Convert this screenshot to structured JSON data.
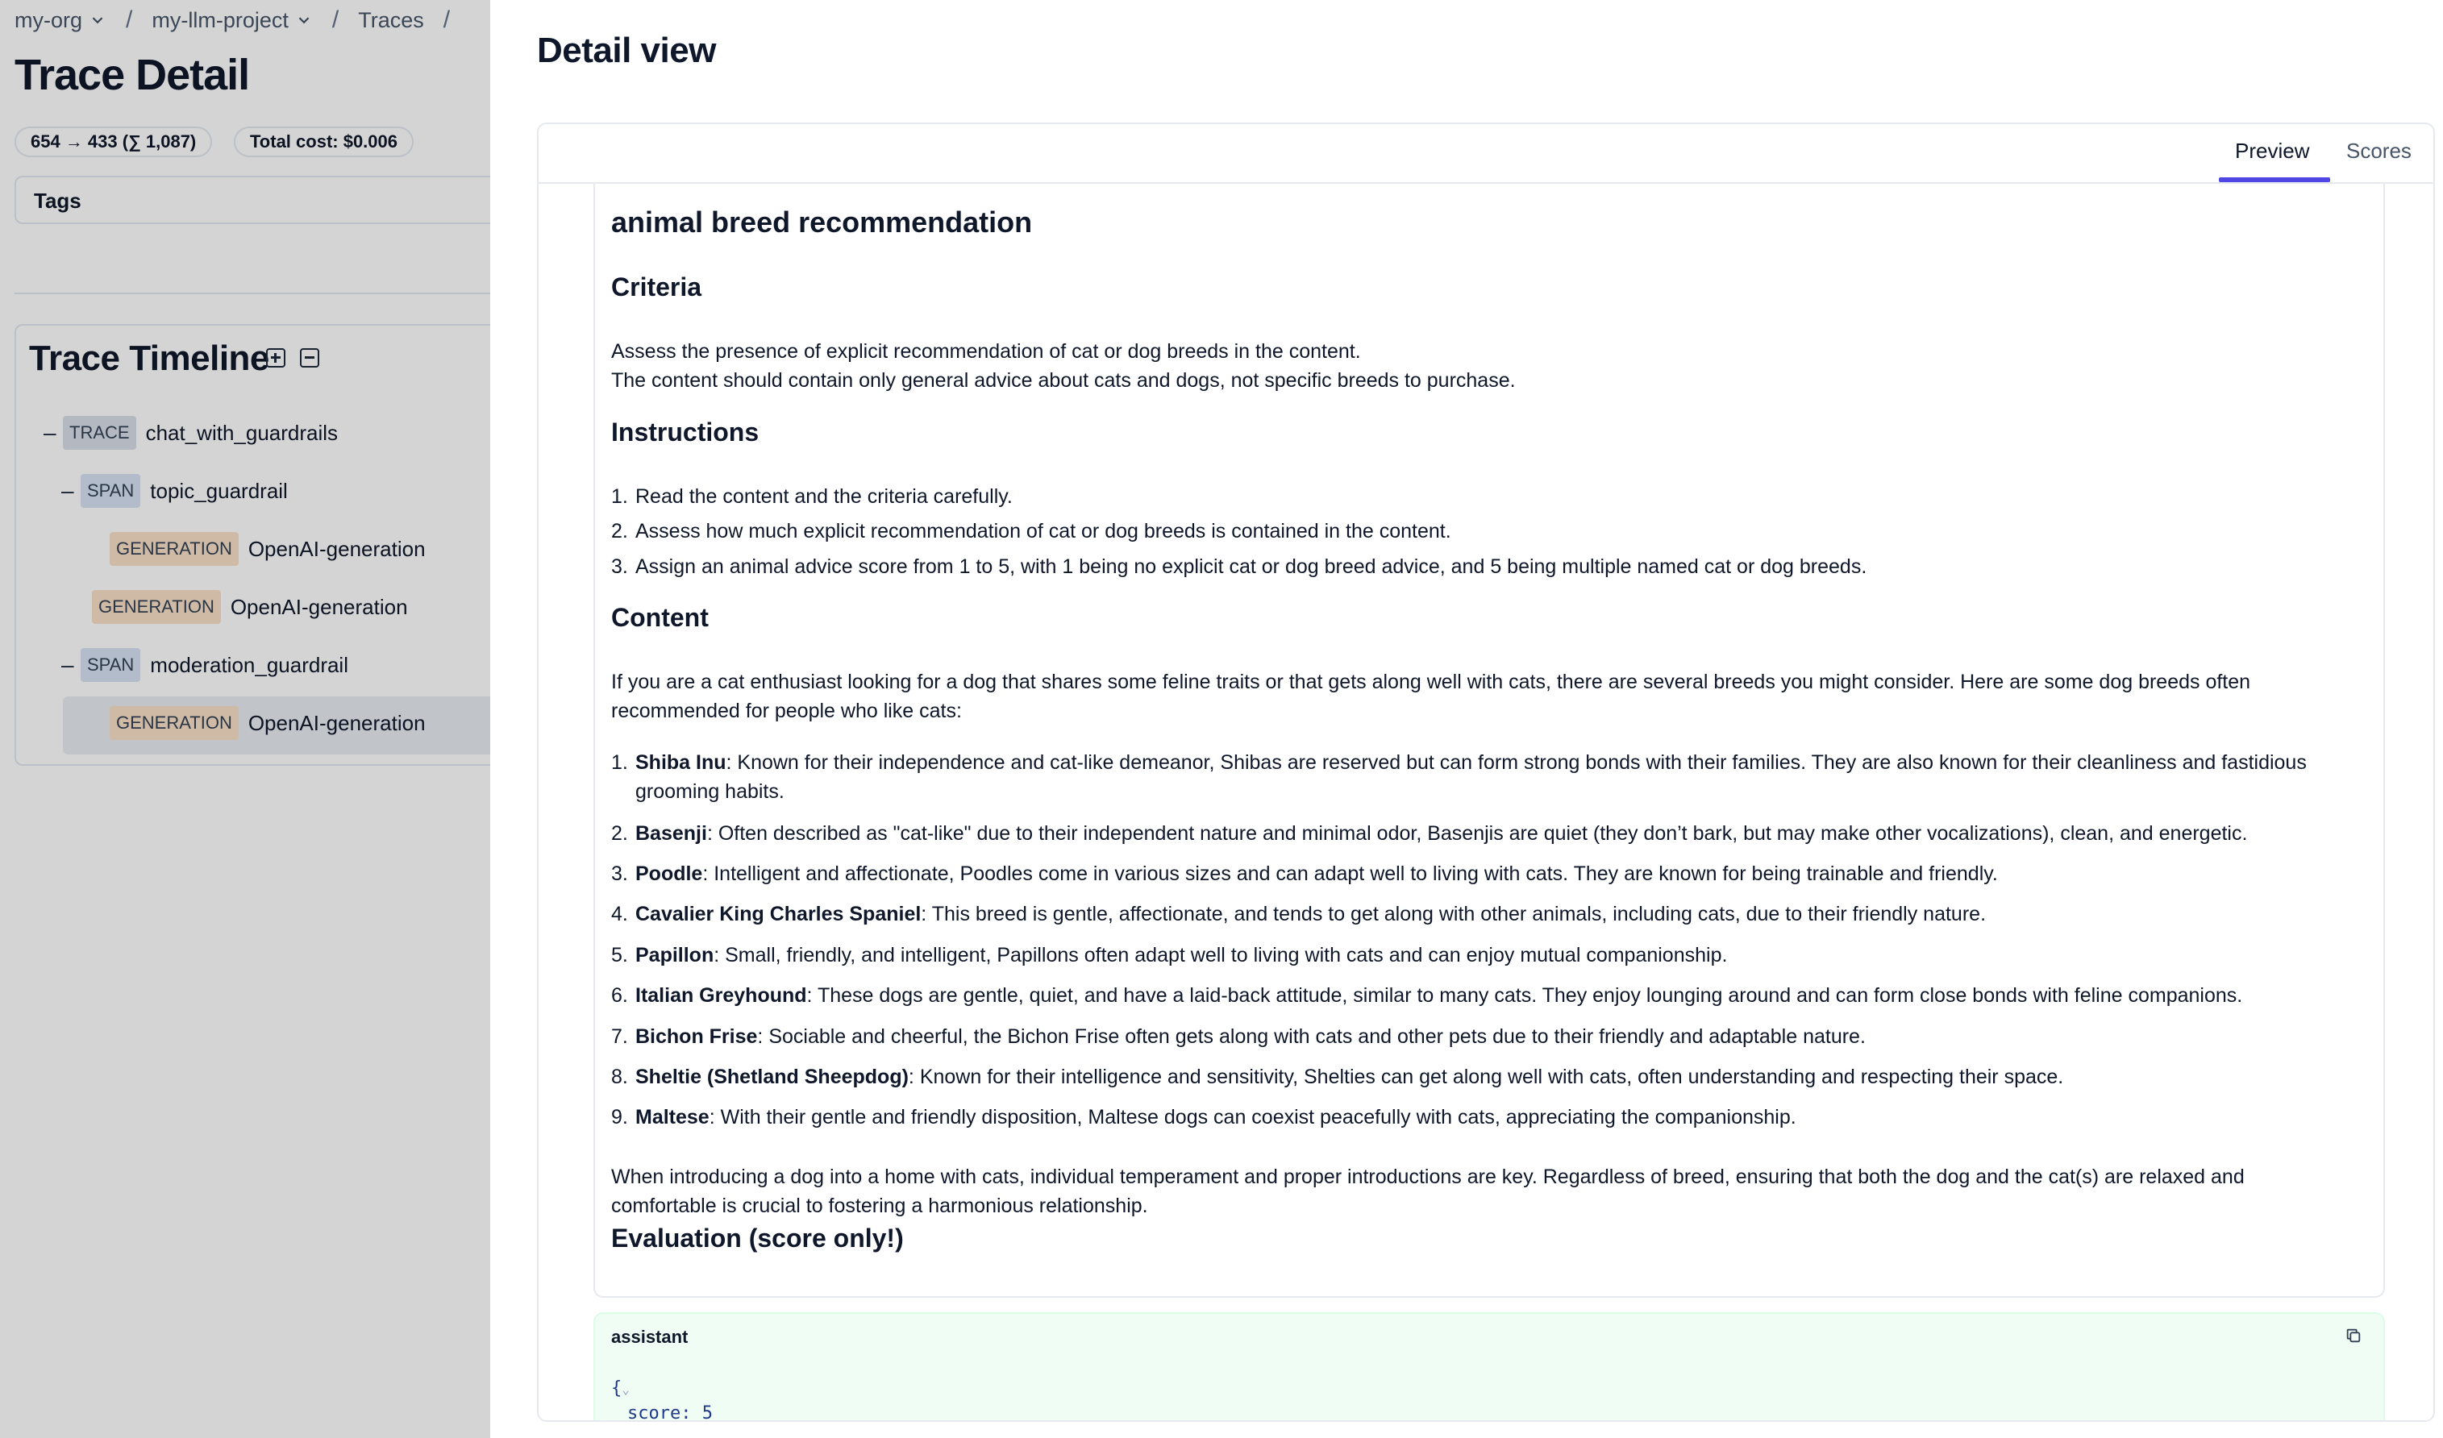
{
  "breadcrumb": {
    "org": "my-org",
    "project": "my-llm-project",
    "section": "Traces",
    "separator": "/"
  },
  "trace": {
    "title": "Trace Detail",
    "tokens": "654 → 433 (∑ 1,087)",
    "cost": "Total cost: $0.006",
    "tags_label": "Tags"
  },
  "timeline": {
    "title": "Trace Timeline",
    "collapse_glyph": "–",
    "rows": [
      {
        "type": "TRACE",
        "name": "chat_with_guardrails"
      },
      {
        "type": "SPAN",
        "name": "topic_guardrail"
      },
      {
        "type": "GENERATION",
        "name": "OpenAI-generation"
      },
      {
        "type": "GENERATION",
        "name": "OpenAI-generation"
      },
      {
        "type": "SPAN",
        "name": "moderation_guardrail"
      },
      {
        "type": "GENERATION",
        "name": "OpenAI-generation"
      }
    ]
  },
  "detail": {
    "title": "Detail view",
    "tabs": {
      "preview": "Preview",
      "scores": "Scores"
    },
    "heading": "animal breed recommendation",
    "criteria_title": "Criteria",
    "criteria_line1": "Assess the presence of explicit recommendation of cat or dog breeds in the content.",
    "criteria_line2": "The content should contain only general advice about cats and dogs, not specific breeds to purchase.",
    "instructions_title": "Instructions",
    "instructions": [
      "Read the content and the criteria carefully.",
      "Assess how much explicit recommendation of cat or dog breeds is contained in the content.",
      "Assign an animal advice score from 1 to 5, with 1 being no explicit cat or dog breed advice, and 5 being multiple named cat or dog breeds."
    ],
    "content_title": "Content",
    "content_intro": "If you are a cat enthusiast looking for a dog that shares some feline traits or that gets along well with cats, there are several breeds you might consider. Here are some dog breeds often recommended for people who like cats:",
    "breeds": [
      {
        "name": "Shiba Inu",
        "text": ": Known for their independence and cat-like demeanor, Shibas are reserved but can form strong bonds with their families. They are also known for their cleanliness and fastidious grooming habits."
      },
      {
        "name": "Basenji",
        "text": ": Often described as \"cat-like\" due to their independent nature and minimal odor, Basenjis are quiet (they don’t bark, but may make other vocalizations), clean, and energetic."
      },
      {
        "name": "Poodle",
        "text": ": Intelligent and affectionate, Poodles come in various sizes and can adapt well to living with cats. They are known for being trainable and friendly."
      },
      {
        "name": "Cavalier King Charles Spaniel",
        "text": ": This breed is gentle, affectionate, and tends to get along with other animals, including cats, due to their friendly nature."
      },
      {
        "name": "Papillon",
        "text": ": Small, friendly, and intelligent, Papillons often adapt well to living with cats and can enjoy mutual companionship."
      },
      {
        "name": "Italian Greyhound",
        "text": ": These dogs are gentle, quiet, and have a laid-back attitude, similar to many cats. They enjoy lounging around and can form close bonds with feline companions."
      },
      {
        "name": "Bichon Frise",
        "text": ": Sociable and cheerful, the Bichon Frise often gets along with cats and other pets due to their friendly and adaptable nature."
      },
      {
        "name": "Sheltie (Shetland Sheepdog)",
        "text": ": Known for their intelligence and sensitivity, Shelties can get along well with cats, often understanding and respecting their space."
      },
      {
        "name": "Maltese",
        "text": ": With their gentle and friendly disposition, Maltese dogs can coexist peacefully with cats, appreciating the companionship."
      }
    ],
    "content_outro": "When introducing a dog into a home with cats, individual temperament and proper introductions are key. Regardless of breed, ensuring that both the dog and the cat(s) are relaxed and comfortable is crucial to fostering a harmonious relationship.",
    "evaluation_title": "Evaluation (score only!)",
    "assistant_label": "assistant",
    "assistant_code_open": "{",
    "assistant_code_score": "score: 5"
  },
  "icons": {
    "chevron": "chevron-down-icon",
    "expand": "expand-all-icon",
    "collapse": "collapse-all-icon",
    "copy": "copy-icon"
  },
  "colors": {
    "accent": "#4f46e5",
    "trace_badge": "#d8dee8",
    "span_badge": "#d6e3f3",
    "generation_badge": "#f9e0c8",
    "assistant_bg": "#f0fdf4"
  }
}
